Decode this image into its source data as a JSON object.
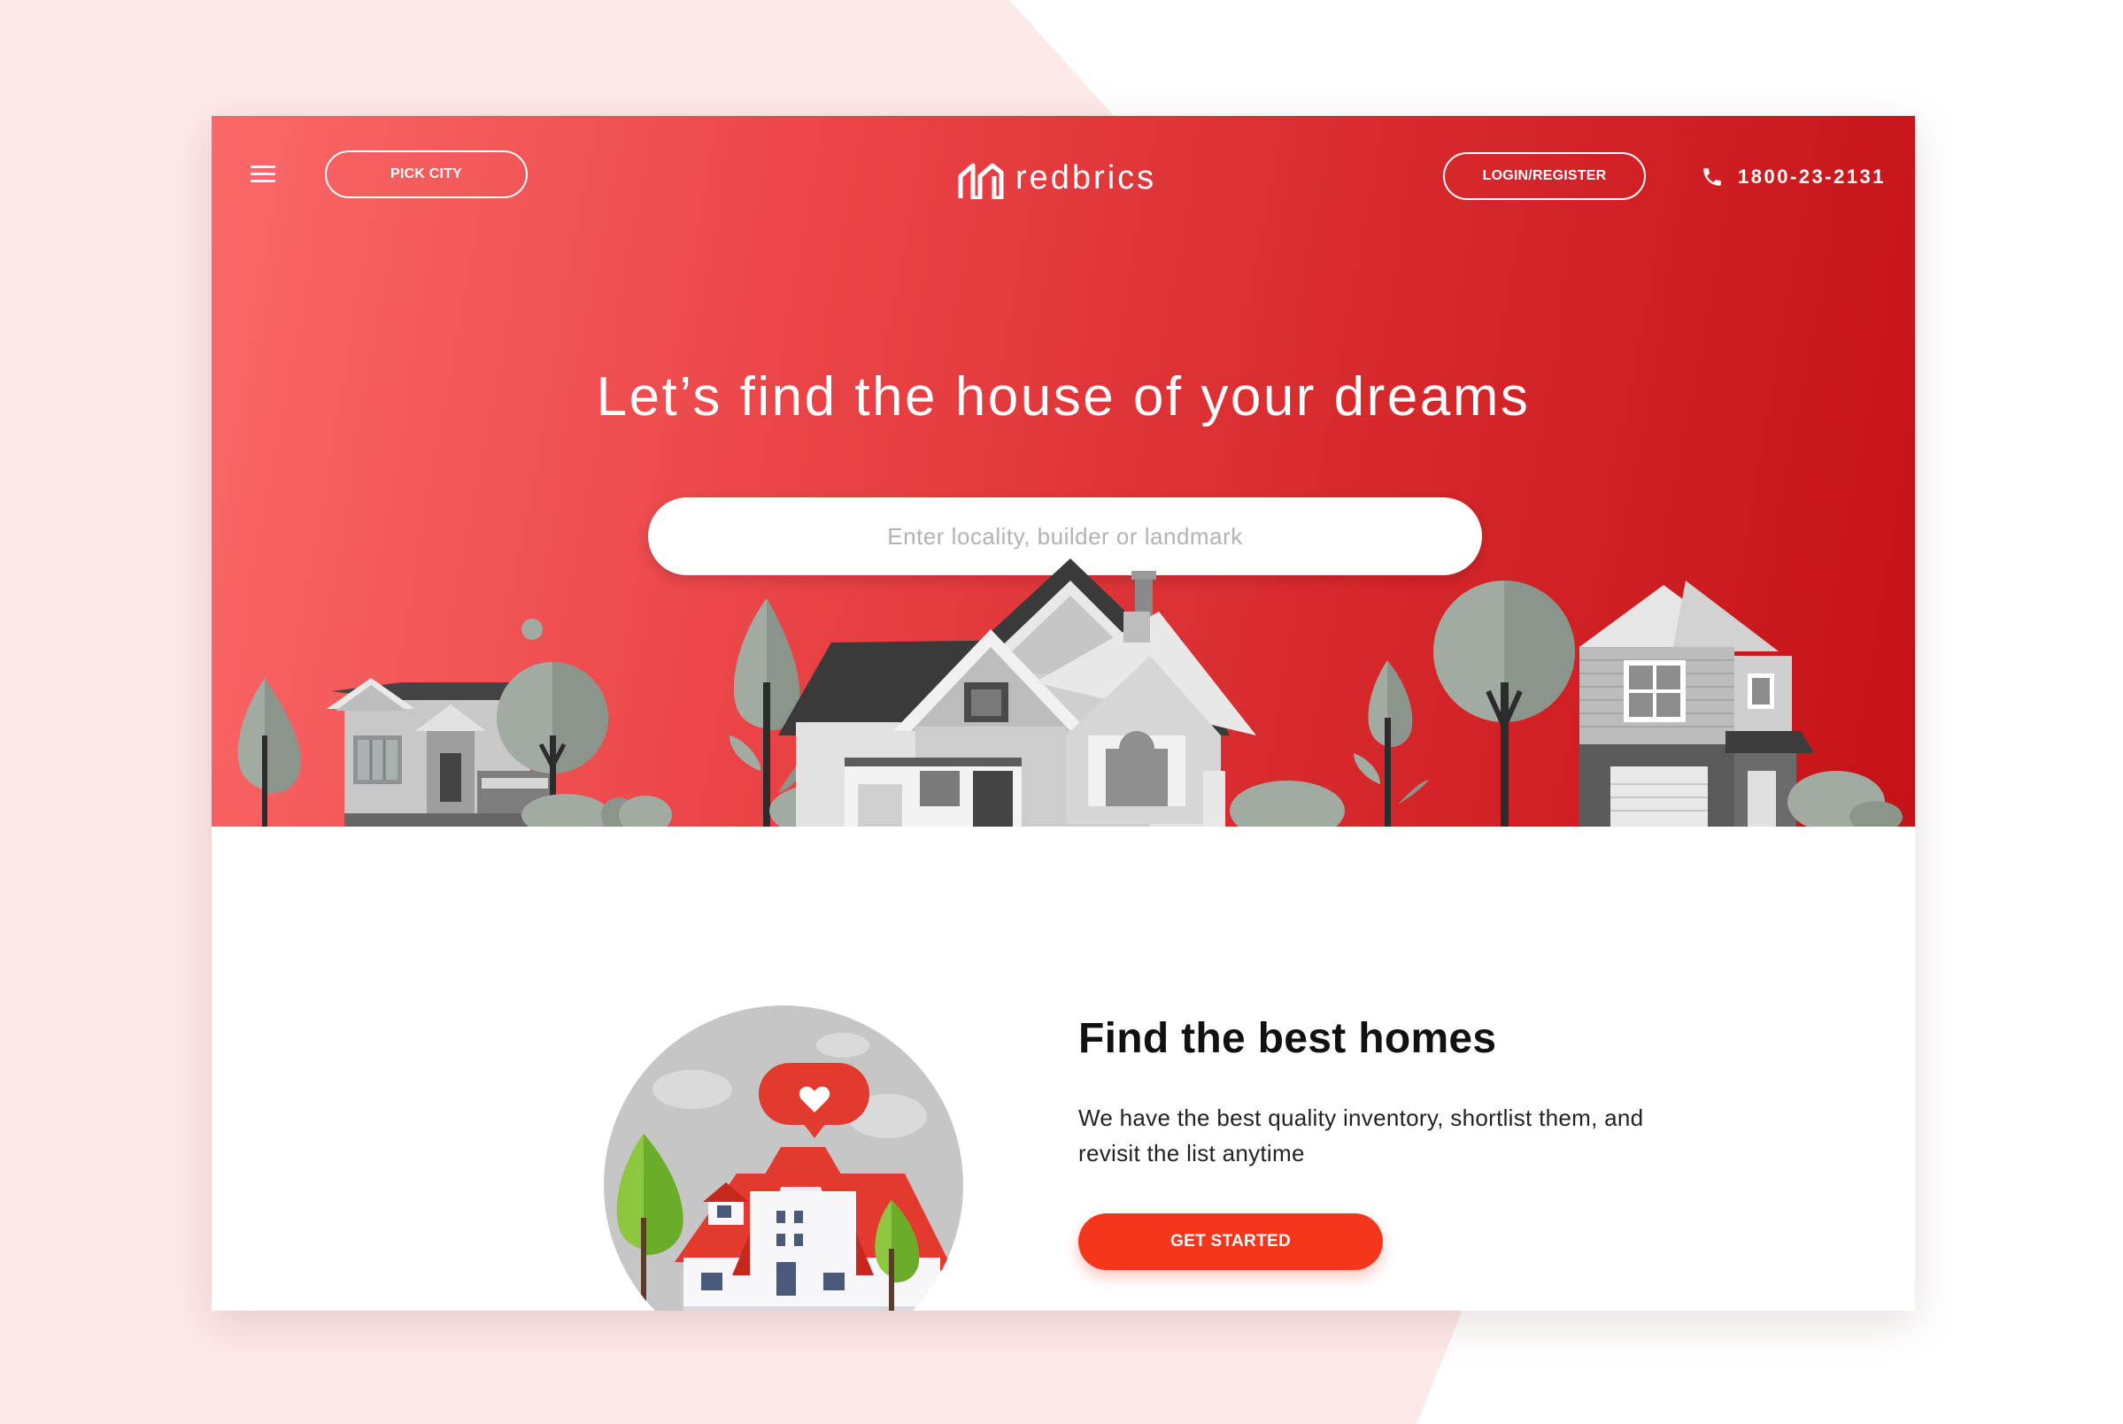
{
  "brand": {
    "name": "redbrics"
  },
  "header": {
    "menu_icon": "hamburger-icon",
    "pick_city_label": "PICK CITY",
    "login_label": "LOGIN/REGISTER",
    "phone_icon": "phone-icon",
    "phone_number": "1800-23-2131"
  },
  "hero": {
    "headline": "Let’s find the house of your dreams",
    "search_placeholder": "Enter locality, builder or landmark"
  },
  "feature": {
    "title": "Find the best homes",
    "text": "We have the best quality inventory, shortlist them, and revisit the list anytime",
    "cta_label": "GET STARTED",
    "icon": "heart-icon"
  },
  "colors": {
    "page_background": "#fde9e8",
    "hero_gradient_start": "#fb6868",
    "hero_gradient_end": "#c51217",
    "cta": "#f5361b"
  }
}
